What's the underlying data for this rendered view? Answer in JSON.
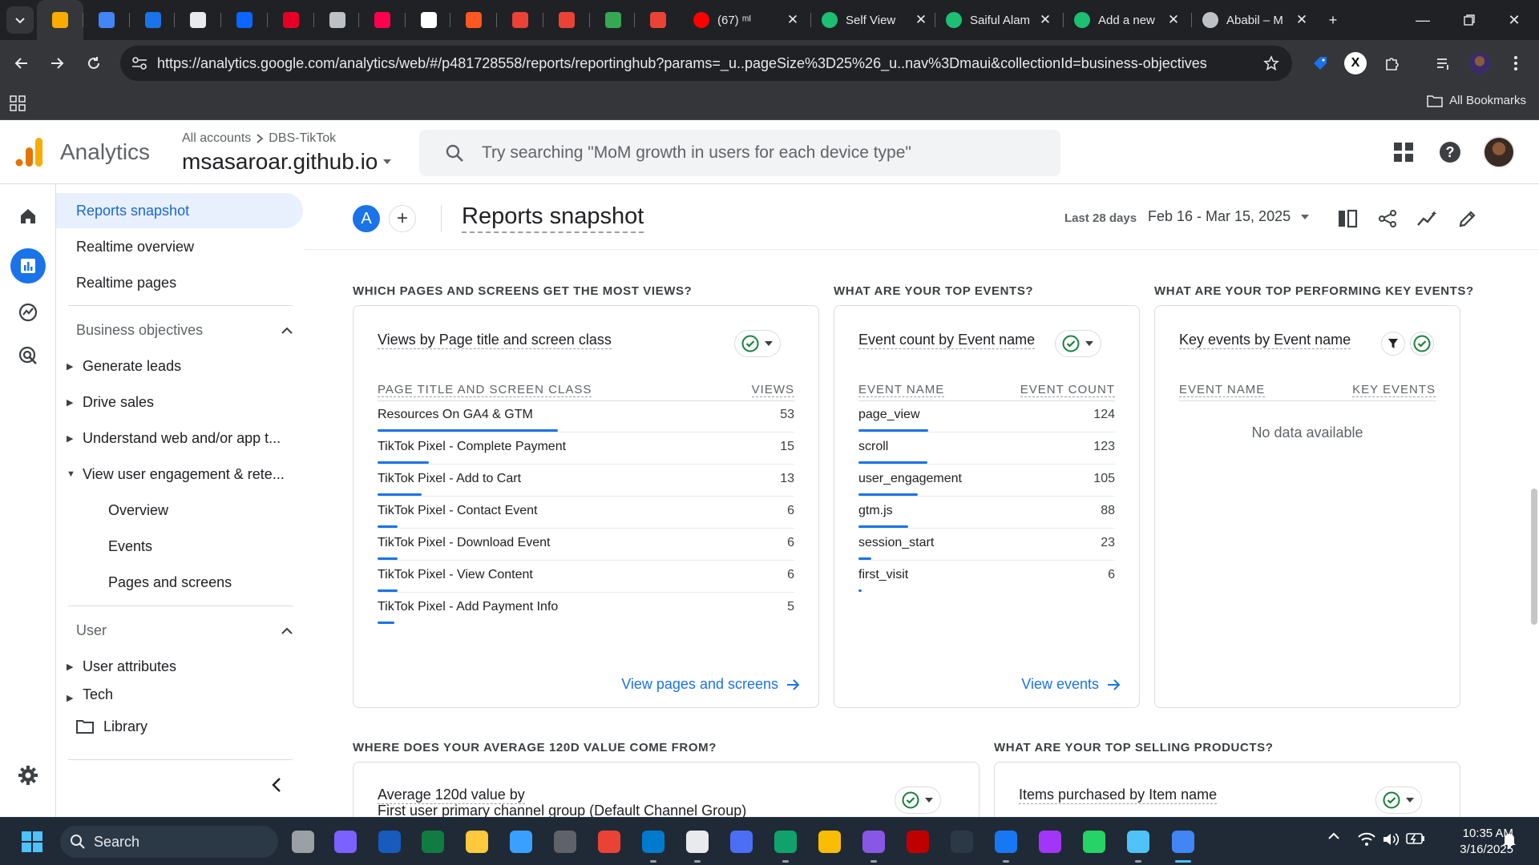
{
  "browser": {
    "pinned_tabs": [
      {
        "name": "analytics-tab",
        "icon": "analytics-favicon",
        "color": "#f9ab00"
      },
      {
        "name": "diamond-tab",
        "icon": "diamond-favicon",
        "color": "#4285f4"
      },
      {
        "name": "drive-tab",
        "icon": "triangle-favicon",
        "color": "#1a73e8"
      },
      {
        "name": "box-tab",
        "icon": "box-favicon",
        "color": "#e8eaed"
      },
      {
        "name": "meta-tab",
        "icon": "meta-favicon",
        "color": "#0a66ff"
      },
      {
        "name": "pinterest-tab",
        "icon": "pinterest-favicon",
        "color": "#e60023"
      },
      {
        "name": "globe-tab",
        "icon": "globe-favicon",
        "color": "#bdc1c6"
      },
      {
        "name": "tiktok-tab",
        "icon": "tiktok-favicon",
        "color": "#ff0050"
      },
      {
        "name": "x-tab",
        "icon": "x-favicon",
        "color": "#ffffff"
      },
      {
        "name": "tinder-tab",
        "icon": "flame-favicon",
        "color": "#ff5722"
      },
      {
        "name": "gmail-tab-1",
        "icon": "gmail-favicon",
        "color": "#ea4335"
      },
      {
        "name": "gmail-tab-2",
        "icon": "gmail-favicon",
        "color": "#ea4335"
      },
      {
        "name": "doc-tab",
        "icon": "doc-favicon",
        "color": "#34a853"
      },
      {
        "name": "gmail-tab-3",
        "icon": "gmail-favicon",
        "color": "#ea4335"
      }
    ],
    "tabs": [
      {
        "title": "(67) ᵐᴵ",
        "icon": "youtube-favicon",
        "color": "#ff0000"
      },
      {
        "title": "Self View",
        "icon": "fiverr-favicon",
        "color": "#1dbf73"
      },
      {
        "title": "Saiful Alam",
        "icon": "fiverr-favicon",
        "color": "#1dbf73"
      },
      {
        "title": "Add a new",
        "icon": "fiverr-favicon",
        "color": "#1dbf73"
      },
      {
        "title": "Ababil – M",
        "icon": "globe-favicon",
        "color": "#bdc1c6"
      }
    ],
    "url": "https://analytics.google.com/analytics/web/#/p481728558/reports/reportinghub?params=_u..pageSize%3D25%26_u..nav%3Dmaui&collectionId=business-objectives",
    "bookmarks_label": "All Bookmarks"
  },
  "ga": {
    "app_name": "Analytics",
    "breadcrumb_account": "All accounts",
    "breadcrumb_property": "DBS-TikTok",
    "property": "msasaroar.github.io",
    "search_placeholder": "Try searching \"MoM growth in users for each device type\""
  },
  "nav": {
    "reports_snapshot": "Reports snapshot",
    "realtime_overview": "Realtime overview",
    "realtime_pages": "Realtime pages",
    "business_objectives": "Business objectives",
    "generate_leads": "Generate leads",
    "drive_sales": "Drive sales",
    "understand": "Understand web and/or app t...",
    "view_engagement": "View user engagement & rete...",
    "overview": "Overview",
    "events": "Events",
    "pages_and_screens": "Pages and screens",
    "user": "User",
    "user_attributes": "User attributes",
    "tech": "Tech",
    "library": "Library"
  },
  "page": {
    "compare_badge": "A",
    "title": "Reports snapshot",
    "date_label": "Last 28 days",
    "date_range": "Feb 16 - Mar 15, 2025"
  },
  "cards": {
    "pages": {
      "section": "WHICH PAGES AND SCREENS GET THE MOST VIEWS?",
      "title": "Views by Page title and screen class",
      "col1": "PAGE TITLE AND SCREEN CLASS",
      "col2": "VIEWS",
      "rows": [
        {
          "name": "Resources On GA4 & GTM",
          "value": 53
        },
        {
          "name": "TikTok Pixel - Complete Payment",
          "value": 15
        },
        {
          "name": "TikTok Pixel - Add to Cart",
          "value": 13
        },
        {
          "name": "TikTok Pixel - Contact Event",
          "value": 6
        },
        {
          "name": "TikTok Pixel - Download Event",
          "value": 6
        },
        {
          "name": "TikTok Pixel - View Content",
          "value": 6
        },
        {
          "name": "TikTok Pixel - Add Payment Info",
          "value": 5
        }
      ],
      "link": "View pages and screens"
    },
    "events": {
      "section": "WHAT ARE YOUR TOP EVENTS?",
      "title": "Event count by Event name",
      "col1": "EVENT NAME",
      "col2": "EVENT COUNT",
      "rows": [
        {
          "name": "page_view",
          "value": 124
        },
        {
          "name": "scroll",
          "value": 123
        },
        {
          "name": "user_engagement",
          "value": 105
        },
        {
          "name": "gtm.js",
          "value": 88
        },
        {
          "name": "session_start",
          "value": 23
        },
        {
          "name": "first_visit",
          "value": 6
        }
      ],
      "link": "View events"
    },
    "key_events": {
      "section": "WHAT ARE YOUR TOP PERFORMING KEY EVENTS?",
      "title": "Key events by Event name",
      "col1": "EVENT NAME",
      "col2": "KEY EVENTS",
      "empty": "No data available"
    },
    "value": {
      "section": "WHERE DOES YOUR AVERAGE 120D VALUE COME FROM?",
      "title": "Average 120d value by",
      "subtitle": "First user primary channel group (Default Channel Group)"
    },
    "products": {
      "section": "WHAT ARE YOUR TOP SELLING PRODUCTS?",
      "title": "Items purchased by Item name"
    }
  },
  "taskbar": {
    "search": "Search",
    "time": "10:35 AM",
    "date": "3/16/2025"
  },
  "colors": {
    "brand_blue": "#1a73e8",
    "check_green": "#188038",
    "chrome_dark": "#202124",
    "chrome_mid": "#35363a",
    "taskbar": "#1f2a36"
  }
}
